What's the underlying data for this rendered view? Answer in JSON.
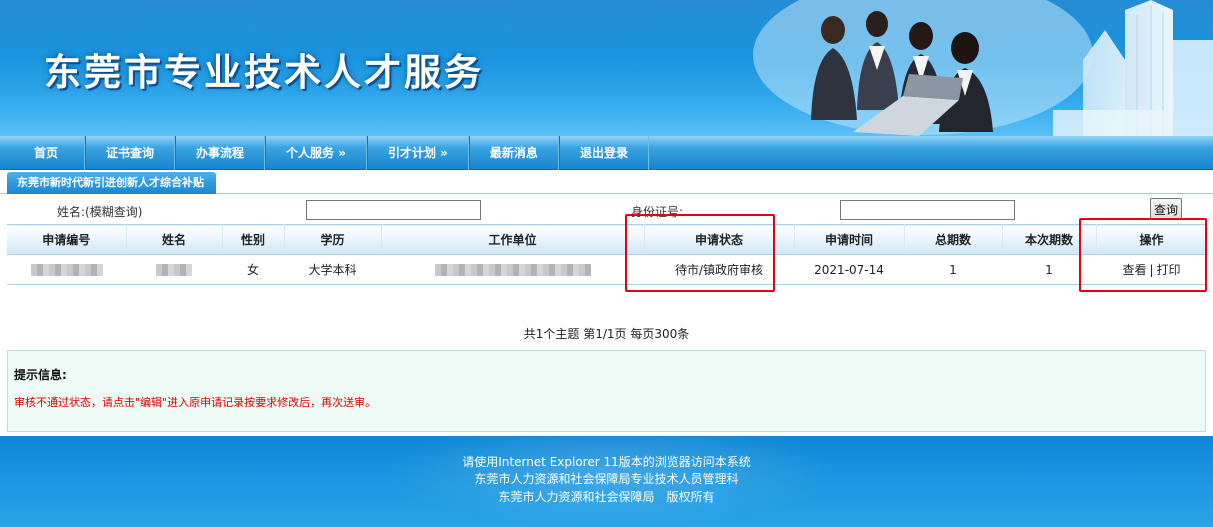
{
  "site": {
    "title": "东莞市专业技术人才服务"
  },
  "nav": {
    "items": [
      {
        "label": "首页"
      },
      {
        "label": "证书查询"
      },
      {
        "label": "办事流程"
      },
      {
        "label": "个人服务 »"
      },
      {
        "label": "引才计划 »"
      },
      {
        "label": "最新消息"
      },
      {
        "label": "退出登录"
      }
    ]
  },
  "subtab": {
    "label": "东莞市新时代新引进创新人才综合补贴"
  },
  "search": {
    "name_label": "姓名:(模糊查询)",
    "name_value": "",
    "id_label": "身份证号:",
    "id_value": "",
    "query_button": "查询"
  },
  "table": {
    "headers": [
      "申请编号",
      "姓名",
      "性别",
      "学历",
      "工作单位",
      "申请状态",
      "申请时间",
      "总期数",
      "本次期数",
      "操作"
    ],
    "rows": [
      {
        "gender": "女",
        "education": "大学本科",
        "status": "待市/镇政府审核",
        "apply_date": "2021-07-14",
        "total_periods": "1",
        "current_period": "1",
        "actions": {
          "view": "查看",
          "print": "打印"
        }
      }
    ]
  },
  "pager": {
    "text": "共1个主题 第1/1页 每页300条"
  },
  "tip": {
    "title": "提示信息:",
    "message": "审核不通过状态，请点击\"编辑\"进入原申请记录按要求修改后，再次送审。"
  },
  "footer": {
    "line1": "请使用Internet Explorer 11版本的浏览器访问本系统",
    "line2": "东莞市人力资源和社会保障局专业技术人员管理科",
    "line3": "东莞市人力资源和社会保障局　版权所有"
  },
  "colors": {
    "highlight": "#e60012",
    "tip_message": "#e00000",
    "banner": "#1a95e0"
  }
}
